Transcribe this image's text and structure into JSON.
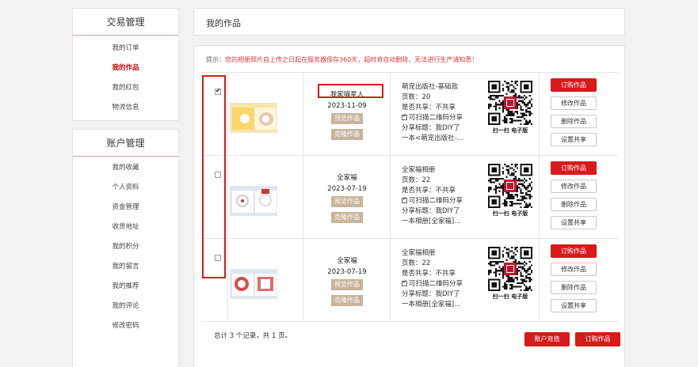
{
  "sidebar": {
    "trade": {
      "title": "交易管理",
      "items": [
        {
          "label": "我的订单"
        },
        {
          "label": "我的作品"
        },
        {
          "label": "我的红包"
        },
        {
          "label": "物流信息"
        }
      ]
    },
    "account": {
      "title": "账户管理",
      "items": [
        {
          "label": "我的收藏"
        },
        {
          "label": "个人资料"
        },
        {
          "label": "资金管理"
        },
        {
          "label": "收货地址"
        },
        {
          "label": "我的积分"
        },
        {
          "label": "我的留言"
        },
        {
          "label": "我的推荐"
        },
        {
          "label": "我的评论"
        },
        {
          "label": "修改密码"
        }
      ]
    }
  },
  "header": {
    "title": "我的作品"
  },
  "tip": {
    "prefix": "提示：",
    "message": "您的相册照片自上传之日起在服务器保存360天，超时将自动删除，无法进行生产请知悉！"
  },
  "rows": [
    {
      "checked": true,
      "name": "我家喵星人",
      "date": "2023-11-09",
      "preview_label": "预览作品",
      "copy_label": "克隆作品",
      "info": {
        "product": "萌宠出版社-基础款",
        "pages": "页数：20",
        "shared": "是否共享：不共享",
        "qr_share": "可扫描二维码分享",
        "share_title_1": "分享标题：我DIY了",
        "share_title_2": "一本<萌宠出版社-..."
      },
      "qr_caption": "扫一扫 电子版",
      "actions": {
        "order": "订购作品",
        "edit": "修改作品",
        "delete": "删除作品",
        "share": "设置共享"
      }
    },
    {
      "checked": false,
      "name": "全家福",
      "date": "2023-07-19",
      "preview_label": "预览作品",
      "copy_label": "克隆作品",
      "info": {
        "product": "全家福相册",
        "pages": "页数：22",
        "shared": "是否共享：不共享",
        "qr_share": "可扫描二维码分享",
        "share_title_1": "分享标题：我DIY了",
        "share_title_2": "一本相册[全家福]..."
      },
      "qr_caption": "扫一扫 电子版",
      "actions": {
        "order": "订购作品",
        "edit": "修改作品",
        "delete": "删除作品",
        "share": "设置共享"
      }
    },
    {
      "checked": false,
      "name": "全家福",
      "date": "2023-07-19",
      "preview_label": "预览作品",
      "copy_label": "克隆作品",
      "info": {
        "product": "全家福相册",
        "pages": "页数：22",
        "shared": "是否共享：不共享",
        "qr_share": "可扫描二维码分享",
        "share_title_1": "分享标题：我DIY了",
        "share_title_2": "一本相册[全家福]..."
      },
      "qr_caption": "扫一扫 电子版",
      "actions": {
        "order": "订购作品",
        "edit": "修改作品",
        "delete": "删除作品",
        "share": "设置共享"
      }
    }
  ],
  "footer": {
    "summary": "总计 3 个记录，共 1 页。",
    "recharge_label": "账户充值",
    "order_label": "订购作品"
  },
  "colors": {
    "accent": "#d71a1a",
    "gold": "#c8b49b"
  }
}
